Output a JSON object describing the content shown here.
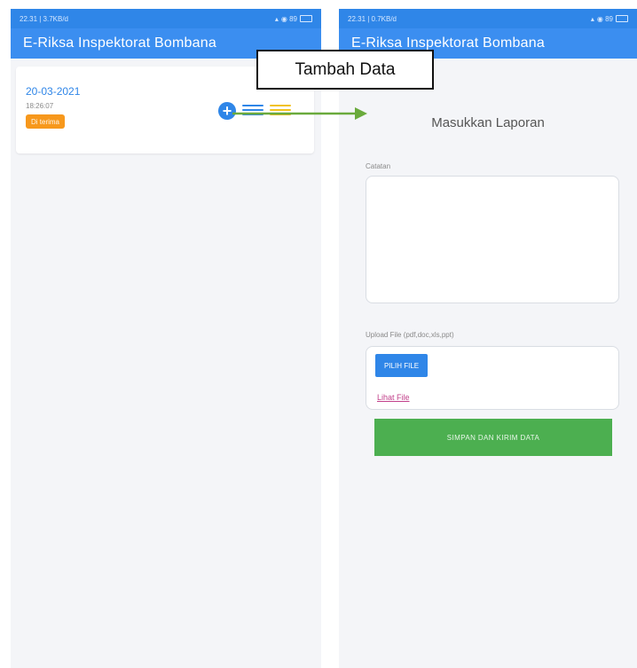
{
  "left_phone": {
    "status_time": "22.31 | 3.7KB/d",
    "status_right": "◉ 89",
    "app_title": "E-Riksa Inspektorat Bombana",
    "card": {
      "date": "20-03-2021",
      "time": "18:26:07",
      "status_badge": "Di terima"
    }
  },
  "right_phone": {
    "status_time": "22.31 | 0.7KB/d",
    "status_right": "◉ 89",
    "app_title": "E-Riksa Inspektorat Bombana",
    "form_title": "Masukkan Laporan",
    "catatan_label": "Catatan",
    "catatan_value": "",
    "upload_label": "Upload File (pdf,doc,xls,ppt)",
    "pilih_file_label": "PILIH FILE",
    "lihat_file_label": "Lihat File",
    "simpan_label": "SIMPAN DAN KIRIM DATA"
  },
  "annotation": {
    "label": "Tambah Data",
    "arrow_color": "#6aaa3c"
  },
  "colors": {
    "appbar": "#3b8ef0",
    "accent_blue": "#2f86e8",
    "badge_orange": "#f7981c",
    "save_green": "#4caf50"
  }
}
